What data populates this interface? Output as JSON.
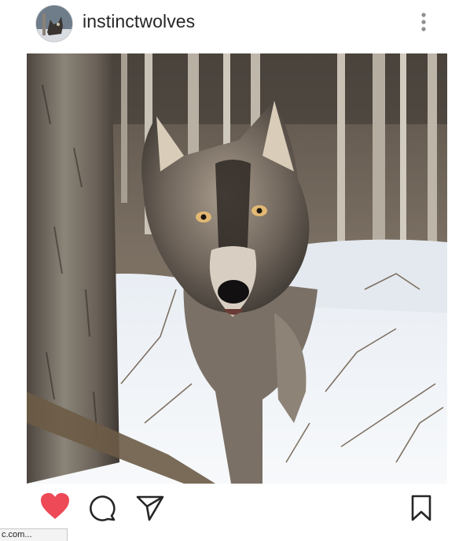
{
  "post": {
    "username": "instinctwolves",
    "avatar_icon": "wolf-avatar",
    "photo_subject": "wolf-in-snowy-forest",
    "liked": true
  },
  "actions": {
    "like_icon": "heart-icon",
    "comment_icon": "comment-icon",
    "share_icon": "send-icon",
    "save_icon": "bookmark-icon"
  },
  "colors": {
    "like_red": "#ed4956",
    "icon_dark": "#262626"
  },
  "status_bar": {
    "text": "c.com..."
  }
}
